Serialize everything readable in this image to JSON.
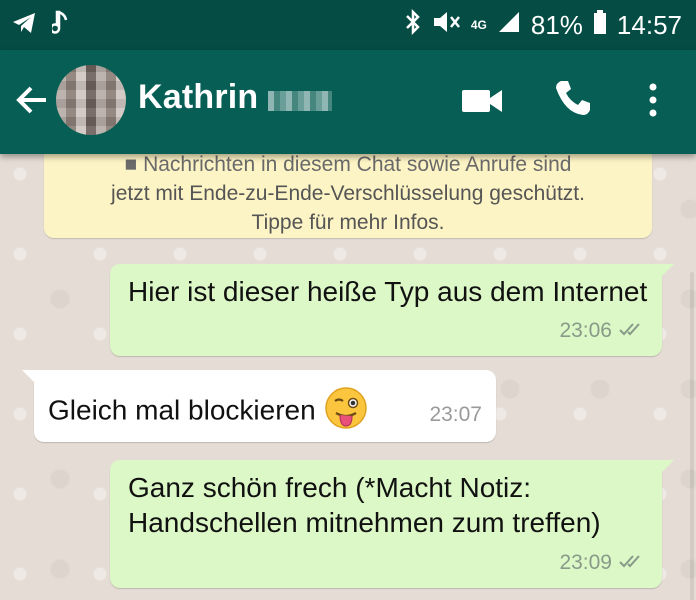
{
  "status_bar": {
    "network_label": "4G",
    "battery_percent": "81%",
    "time": "14:57",
    "icons": [
      "telegram-icon",
      "music-note-icon",
      "bluetooth-icon",
      "vibrate-mute-icon",
      "signal-icon",
      "battery-icon"
    ]
  },
  "header": {
    "contact_name": "Kathrin",
    "icons": [
      "back-arrow-icon",
      "video-call-icon",
      "phone-icon",
      "more-vert-icon"
    ]
  },
  "system_message": {
    "line1": "Nachrichten in diesem Chat sowie Anrufe sind",
    "line2": "jetzt mit Ende-zu-Ende-Verschlüsselung geschützt.",
    "line3": "Tippe für mehr Infos."
  },
  "messages": [
    {
      "direction": "out",
      "text": "Hier ist dieser heiße Typ aus dem Internet",
      "time": "23:06",
      "ticks": "double-check-icon"
    },
    {
      "direction": "in",
      "text": "Gleich mal blockieren",
      "time": "23:07",
      "emoji": "winking-face-tongue-emoji"
    },
    {
      "direction": "out",
      "text": "Ganz schön frech (*Macht Notiz: Handschellen mitnehmen zum treffen)",
      "time": "23:09",
      "ticks": "double-check-icon"
    }
  ],
  "colors": {
    "status_bar": "#054d44",
    "app_bar": "#075e54",
    "outgoing_bubble": "#dcf8c6",
    "incoming_bubble": "#ffffff",
    "system_bubble": "#fdf4c5",
    "chat_background": "#e5ddd5"
  }
}
